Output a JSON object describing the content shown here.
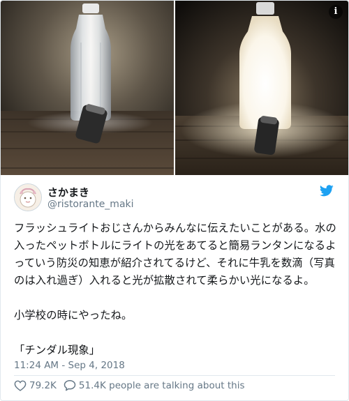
{
  "media": {
    "info_icon": "info-icon",
    "photos": [
      {
        "name": "water-bottle-lit-clear",
        "icon": "photo"
      },
      {
        "name": "water-bottle-lit-milky",
        "icon": "photo"
      }
    ],
    "info_glyph": "i"
  },
  "author": {
    "display_name": "さかまき",
    "handle": "@ristorante_maki",
    "avatar_icon": "avatar-illustration",
    "platform_icon": "twitter-bird-icon"
  },
  "tweet": {
    "text": "フラッシュライトおじさんからみんなに伝えたいことがある。水の入ったペットボトルにライトの光をあてると簡易ランタンになるよっていう防災の知恵が紹介されてるけど、それに牛乳を数滴（写真のは入れ過ぎ）入れると光が拡散されて柔らかい光になるよ。\n\n小学校の時にやったね。\n\n「チンダル現象」",
    "timestamp": "11:24 AM - Sep 4, 2018"
  },
  "actions": {
    "likes": "79.2K",
    "replies_text": "51.4K people are talking about this",
    "like_icon": "heart-icon",
    "reply_icon": "speech-bubble-icon"
  },
  "colors": {
    "text": "#14171a",
    "secondary": "#657786",
    "twitter_blue": "#1da1f2",
    "border": "#e1e8ed"
  }
}
